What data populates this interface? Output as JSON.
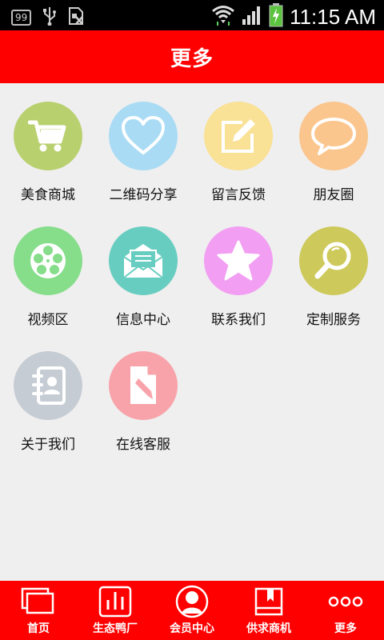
{
  "status_bar": {
    "time": "11:15 AM",
    "notification_count": "99"
  },
  "header": {
    "title": "更多"
  },
  "grid": {
    "items": [
      {
        "label": "美食商城",
        "icon": "cart-icon",
        "color": "#b9d06f"
      },
      {
        "label": "二维码分享",
        "icon": "heart-icon",
        "color": "#a9dbf5"
      },
      {
        "label": "留言反馈",
        "icon": "edit-note-icon",
        "color": "#f9e195"
      },
      {
        "label": "朋友圈",
        "icon": "chat-bubble-icon",
        "color": "#fbc58e"
      },
      {
        "label": "视频区",
        "icon": "film-reel-icon",
        "color": "#86dd8a"
      },
      {
        "label": "信息中心",
        "icon": "mail-open-icon",
        "color": "#68cdc1"
      },
      {
        "label": "联系我们",
        "icon": "star-icon",
        "color": "#f29ef2"
      },
      {
        "label": "定制服务",
        "icon": "magnifier-icon",
        "color": "#cdc95b"
      },
      {
        "label": "关于我们",
        "icon": "contact-book-icon",
        "color": "#c6ccd4"
      },
      {
        "label": "在线客服",
        "icon": "pencil-doc-icon",
        "color": "#f8a3aa"
      }
    ]
  },
  "tabbar": {
    "tabs": [
      {
        "label": "首页",
        "icon": "windows-icon"
      },
      {
        "label": "生态鸭厂",
        "icon": "bar-chart-icon"
      },
      {
        "label": "会员中心",
        "icon": "user-avatar-icon"
      },
      {
        "label": "供求商机",
        "icon": "book-bookmark-icon"
      },
      {
        "label": "更多",
        "icon": "more-dots-icon"
      }
    ]
  },
  "colors": {
    "header": "#ff0000",
    "background": "#efefef"
  }
}
